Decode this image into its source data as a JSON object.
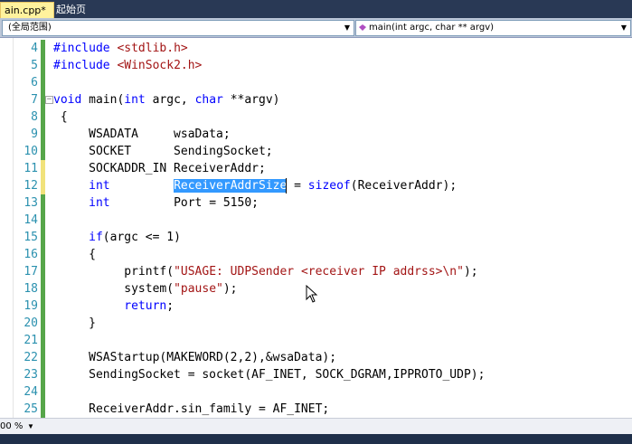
{
  "tabs": [
    {
      "label": "ain.cpp*",
      "active": true
    },
    {
      "label": "起始页",
      "active": false
    }
  ],
  "nav": {
    "scope": "(全局范围)",
    "member": "main(int argc, char ** argv)"
  },
  "editor": {
    "lines": [
      {
        "n": "4",
        "tokens": [
          [
            "pp",
            "#include "
          ],
          [
            "str",
            "<stdlib.h>"
          ]
        ]
      },
      {
        "n": "5",
        "tokens": [
          [
            "pp",
            "#include "
          ],
          [
            "str",
            "<WinSock2.h>"
          ]
        ]
      },
      {
        "n": "6",
        "tokens": []
      },
      {
        "n": "7",
        "tokens": [
          [
            "kw",
            "void"
          ],
          [
            "t",
            " main("
          ],
          [
            "kw",
            "int"
          ],
          [
            "t",
            " argc, "
          ],
          [
            "kw",
            "char"
          ],
          [
            "t",
            " **argv)"
          ]
        ]
      },
      {
        "n": "8",
        "tokens": [
          [
            "t",
            " {"
          ]
        ]
      },
      {
        "n": "9",
        "tokens": [
          [
            "t",
            "     WSADATA     wsaData;"
          ]
        ]
      },
      {
        "n": "10",
        "tokens": [
          [
            "t",
            "     SOCKET      SendingSocket;"
          ]
        ]
      },
      {
        "n": "11",
        "tokens": [
          [
            "t",
            "     SOCKADDR_IN ReceiverAddr;"
          ]
        ]
      },
      {
        "n": "12",
        "tokens": [
          [
            "t",
            "     "
          ],
          [
            "kw",
            "int"
          ],
          [
            "t",
            "         "
          ],
          [
            "sel",
            "ReceiverAddrSize"
          ],
          [
            "t",
            " = "
          ],
          [
            "kw",
            "sizeof"
          ],
          [
            "t",
            "(ReceiverAddr);"
          ]
        ]
      },
      {
        "n": "13",
        "tokens": [
          [
            "t",
            "     "
          ],
          [
            "kw",
            "int"
          ],
          [
            "t",
            "         Port = 5150;"
          ]
        ]
      },
      {
        "n": "14",
        "tokens": []
      },
      {
        "n": "15",
        "tokens": [
          [
            "t",
            "     "
          ],
          [
            "kw",
            "if"
          ],
          [
            "t",
            "(argc <= 1)"
          ]
        ]
      },
      {
        "n": "16",
        "tokens": [
          [
            "t",
            "     {"
          ]
        ]
      },
      {
        "n": "17",
        "tokens": [
          [
            "t",
            "          printf("
          ],
          [
            "str",
            "\"USAGE: UDPSender <receiver IP addrss>\\n\""
          ],
          [
            "t",
            ");"
          ]
        ]
      },
      {
        "n": "18",
        "tokens": [
          [
            "t",
            "          system("
          ],
          [
            "str",
            "\"pause\""
          ],
          [
            "t",
            ");"
          ]
        ]
      },
      {
        "n": "19",
        "tokens": [
          [
            "t",
            "          "
          ],
          [
            "kw",
            "return"
          ],
          [
            "t",
            ";"
          ]
        ]
      },
      {
        "n": "20",
        "tokens": [
          [
            "t",
            "     }"
          ]
        ]
      },
      {
        "n": "21",
        "tokens": []
      },
      {
        "n": "22",
        "tokens": [
          [
            "t",
            "     WSAStartup(MAKEWORD(2,2),&wsaData);"
          ]
        ]
      },
      {
        "n": "23",
        "tokens": [
          [
            "t",
            "     SendingSocket = socket(AF_INET, SOCK_DGRAM,IPPROTO_UDP);"
          ]
        ]
      },
      {
        "n": "24",
        "tokens": []
      },
      {
        "n": "25",
        "tokens": [
          [
            "t",
            "     ReceiverAddr.sin_family = AF_INET;"
          ]
        ]
      }
    ]
  },
  "zoom": "00 %",
  "colors": {
    "keyword": "#0000ff",
    "string": "#a31515",
    "line_number": "#2b91af",
    "selection": "#3399ff",
    "tab_strip": "#293955",
    "active_tab": "#fff29d"
  }
}
